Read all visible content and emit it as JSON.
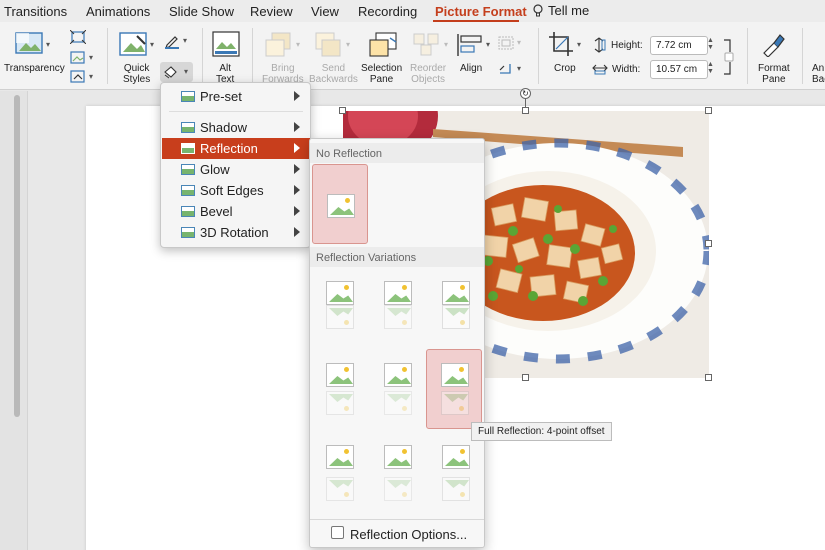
{
  "tabs": {
    "items": [
      "Transitions",
      "Animations",
      "Slide Show",
      "Review",
      "View",
      "Recording",
      "Picture Format"
    ],
    "active": "Picture Format",
    "tell_me": "Tell me"
  },
  "ribbon": {
    "transparency": "Transparency",
    "quick_styles": [
      "Quick",
      "Styles"
    ],
    "alt_text": [
      "Alt",
      "Text"
    ],
    "bring_forwards": [
      "Bring",
      "Forwards"
    ],
    "send_backwards": [
      "Send",
      "Backwards"
    ],
    "selection_pane": [
      "Selection",
      "Pane"
    ],
    "reorder_objects": [
      "Reorder",
      "Objects"
    ],
    "align": "Align",
    "crop": "Crop",
    "height_label": "Height:",
    "height_value": "7.72 cm",
    "width_label": "Width:",
    "width_value": "10.57 cm",
    "format_pane": [
      "Format",
      "Pane"
    ],
    "next_cut": [
      "An",
      "Bac"
    ]
  },
  "effects_menu": {
    "items": [
      {
        "label": "Pre-set",
        "selected": false
      },
      {
        "label": "Shadow",
        "selected": false
      },
      {
        "label": "Reflection",
        "selected": true
      },
      {
        "label": "Glow",
        "selected": false
      },
      {
        "label": "Soft Edges",
        "selected": false
      },
      {
        "label": "Bevel",
        "selected": false
      },
      {
        "label": "3D Rotation",
        "selected": false
      }
    ]
  },
  "reflection_gallery": {
    "no_reflection_header": "No Reflection",
    "variations_header": "Reflection Variations",
    "options_label": "Reflection Options...",
    "tooltip": "Full Reflection: 4-point offset"
  },
  "colors": {
    "accent": "#c43e1c",
    "menu_selected": "#c83e1c",
    "highlight": "#f1cfcf"
  }
}
